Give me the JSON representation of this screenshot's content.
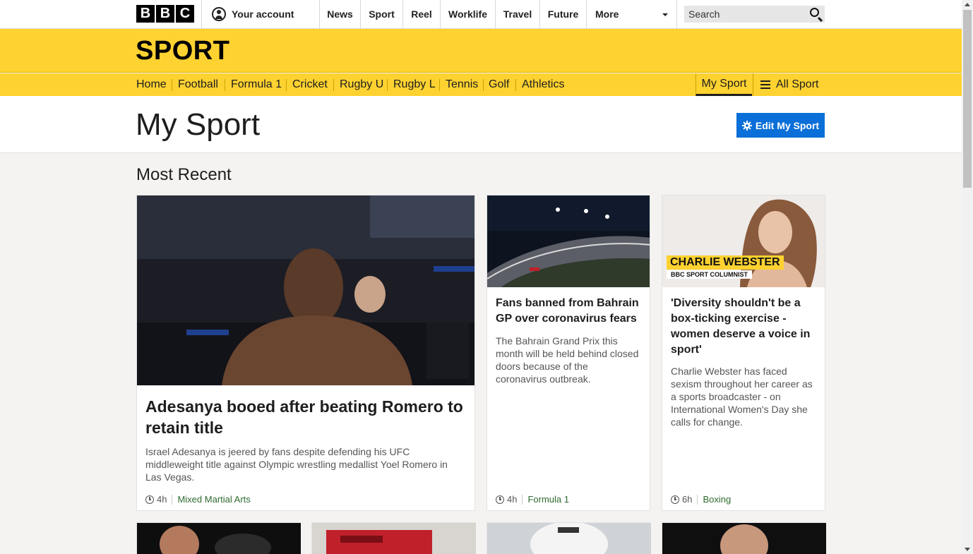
{
  "global_nav": {
    "logo_letters": [
      "B",
      "B",
      "C"
    ],
    "account_label": "Your account",
    "items": [
      "News",
      "Sport",
      "Reel",
      "Worklife",
      "Travel",
      "Future",
      "More"
    ],
    "search_placeholder": "Search"
  },
  "sport_header": {
    "title": "SPORT",
    "nav": [
      "Home",
      "Football",
      "Formula 1",
      "Cricket",
      "Rugby U",
      "Rugby L",
      "Tennis",
      "Golf",
      "Athletics"
    ],
    "my_sport": "My Sport",
    "all_sport": "All Sport",
    "accent_color": "#fed230"
  },
  "page": {
    "title": "My Sport",
    "edit_button": "Edit My Sport",
    "section_title": "Most Recent"
  },
  "cards": [
    {
      "headline": "Adesanya booed after beating Romero to retain title",
      "summary": "Israel Adesanya is jeered by fans despite defending his UFC middleweight title against Olympic wrestling medallist Yoel Romero in Las Vegas.",
      "time": "4h",
      "tag": "Mixed Martial Arts"
    },
    {
      "headline": "Fans banned from Bahrain GP over coronavirus fears",
      "summary": "The Bahrain Grand Prix this month will be held behind closed doors because of the coronavirus outbreak.",
      "time": "4h",
      "tag": "Formula 1"
    },
    {
      "headline": "'Diversity shouldn't be a box-ticking exercise - women deserve a voice in sport'",
      "summary": "Charlie Webster has faced sexism throughout her career as a sports broadcaster - on International Women's Day she calls for change.",
      "time": "6h",
      "tag": "Boxing",
      "image_caption_name": "CHARLIE WEBSTER",
      "image_caption_role": "BBC SPORT COLUMNIST"
    }
  ]
}
